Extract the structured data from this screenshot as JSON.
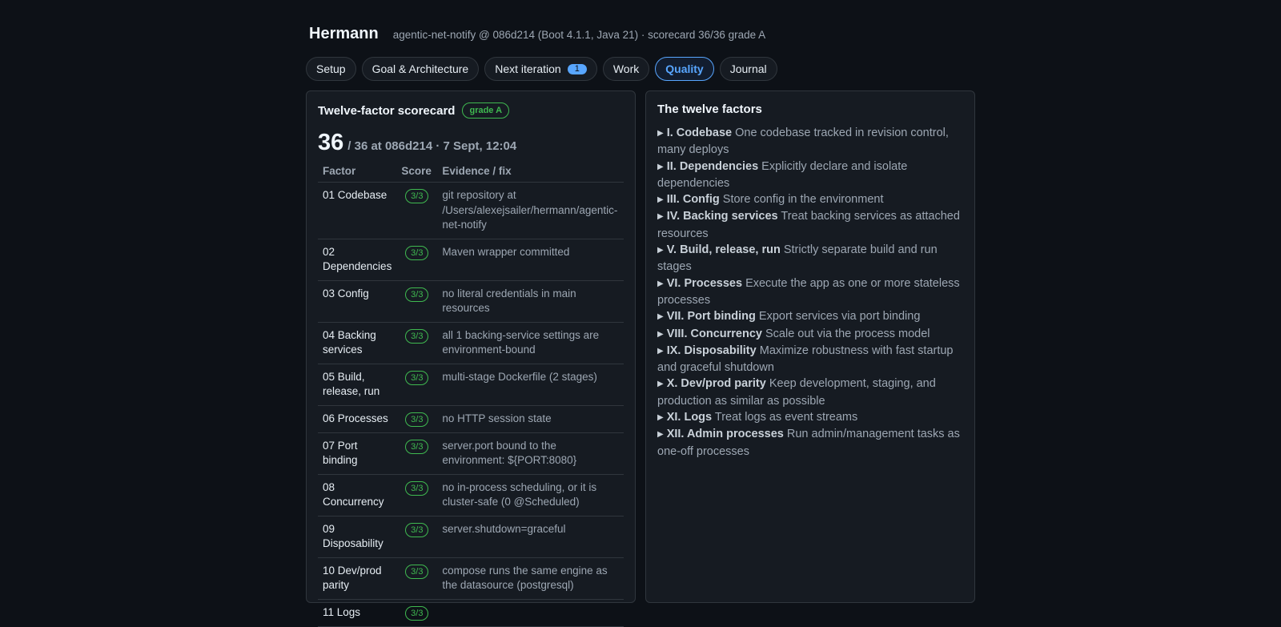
{
  "header": {
    "title": "Hermann",
    "subtitle": "agentic-net-notify @ 086d214 (Boot 4.1.1, Java 21) · scorecard 36/36 grade A"
  },
  "tabs": [
    {
      "label": "Setup"
    },
    {
      "label": "Goal & Architecture"
    },
    {
      "label": "Next iteration",
      "badge": "1"
    },
    {
      "label": "Work"
    },
    {
      "label": "Quality",
      "active": true
    },
    {
      "label": "Journal"
    }
  ],
  "scorecard": {
    "title": "Twelve-factor scorecard",
    "grade": "grade A",
    "score": "36",
    "score_suffix": "/ 36 at 086d214 · 7 Sept, 12:04",
    "columns": [
      "Factor",
      "Score",
      "Evidence / fix"
    ],
    "rows": [
      {
        "factor": "01 Codebase",
        "score": "3/3",
        "evidence": "git repository at /Users/alexejsailer/hermann/agentic-net-notify"
      },
      {
        "factor": "02 Dependencies",
        "score": "3/3",
        "evidence": "Maven wrapper committed"
      },
      {
        "factor": "03 Config",
        "score": "3/3",
        "evidence": "no literal credentials in main resources"
      },
      {
        "factor": "04 Backing services",
        "score": "3/3",
        "evidence": "all 1 backing-service settings are environment-bound"
      },
      {
        "factor": "05 Build, release, run",
        "score": "3/3",
        "evidence": "multi-stage Dockerfile (2 stages)"
      },
      {
        "factor": "06 Processes",
        "score": "3/3",
        "evidence": "no HTTP session state"
      },
      {
        "factor": "07 Port binding",
        "score": "3/3",
        "evidence": "server.port bound to the environment: ${PORT:8080}"
      },
      {
        "factor": "08 Concurrency",
        "score": "3/3",
        "evidence": "no in-process scheduling, or it is cluster-safe (0 @Scheduled)"
      },
      {
        "factor": "09 Disposability",
        "score": "3/3",
        "evidence": "server.shutdown=graceful"
      },
      {
        "factor": "10 Dev/prod parity",
        "score": "3/3",
        "evidence": "compose runs the same engine as the datasource (postgresql)"
      },
      {
        "factor": "11 Logs",
        "score": "3/3",
        "evidence": ""
      }
    ]
  },
  "factors_panel": {
    "title": "The twelve factors",
    "items": [
      {
        "name": "I. Codebase",
        "desc": "One codebase tracked in revision control, many deploys"
      },
      {
        "name": "II. Dependencies",
        "desc": "Explicitly declare and isolate dependencies"
      },
      {
        "name": "III. Config",
        "desc": "Store config in the environment"
      },
      {
        "name": "IV. Backing services",
        "desc": "Treat backing services as attached resources"
      },
      {
        "name": "V. Build, release, run",
        "desc": "Strictly separate build and run stages"
      },
      {
        "name": "VI. Processes",
        "desc": "Execute the app as one or more stateless processes"
      },
      {
        "name": "VII. Port binding",
        "desc": "Export services via port binding"
      },
      {
        "name": "VIII. Concurrency",
        "desc": "Scale out via the process model"
      },
      {
        "name": "IX. Disposability",
        "desc": "Maximize robustness with fast startup and graceful shutdown"
      },
      {
        "name": "X. Dev/prod parity",
        "desc": "Keep development, staging, and production as similar as possible"
      },
      {
        "name": "XI. Logs",
        "desc": "Treat logs as event streams"
      },
      {
        "name": "XII. Admin processes",
        "desc": "Run admin/management tasks as one-off processes"
      }
    ]
  }
}
